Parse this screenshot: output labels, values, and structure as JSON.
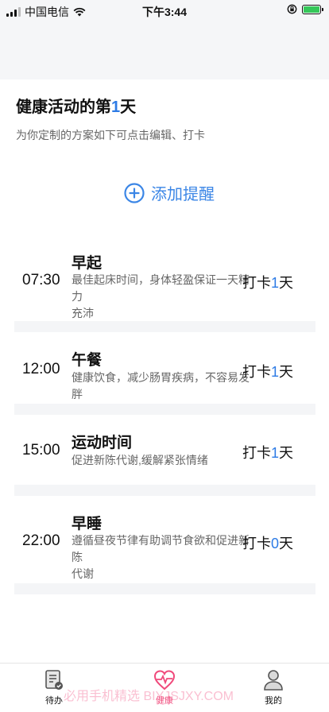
{
  "status_bar": {
    "carrier": "中国电信",
    "time": "下午3:44"
  },
  "header": {
    "title_prefix": "健康活动的第",
    "title_day": "1",
    "title_suffix": "天",
    "subtitle": "为你定制的方案如下可点击编辑、打卡"
  },
  "add_reminder": {
    "label": "添加提醒"
  },
  "reminders": [
    {
      "time": "07:30",
      "title": "早起",
      "desc_line1": "最佳起床时间，身体轻盈保证一天精力",
      "desc_line2": "充沛",
      "checkin_prefix": "打卡",
      "checkin_days": "1",
      "checkin_suffix": "天"
    },
    {
      "time": "12:00",
      "title": "午餐",
      "desc_line1": "健康饮食，减少肠胃疾病，不容易发胖",
      "desc_line2": "",
      "checkin_prefix": "打卡",
      "checkin_days": "1",
      "checkin_suffix": "天"
    },
    {
      "time": "15:00",
      "title": "运动时间",
      "desc_line1": "促进新陈代谢,缓解紧张情绪",
      "desc_line2": "",
      "checkin_prefix": "打卡",
      "checkin_days": "1",
      "checkin_suffix": "天"
    },
    {
      "time": "22:00",
      "title": "早睡",
      "desc_line1": "遵循昼夜节律有助调节食欲和促进新陈",
      "desc_line2": "代谢",
      "checkin_prefix": "打卡",
      "checkin_days": "0",
      "checkin_suffix": "天"
    }
  ],
  "tabs": [
    {
      "label": "待办",
      "icon": "todo-icon"
    },
    {
      "label": "健康",
      "icon": "heart-pulse-icon",
      "active": true
    },
    {
      "label": "我的",
      "icon": "user-icon"
    }
  ],
  "watermark": "必用手机精选 BIYJSJXY.COM",
  "colors": {
    "accent": "#2d7be5",
    "active_tab": "#f0497b"
  }
}
